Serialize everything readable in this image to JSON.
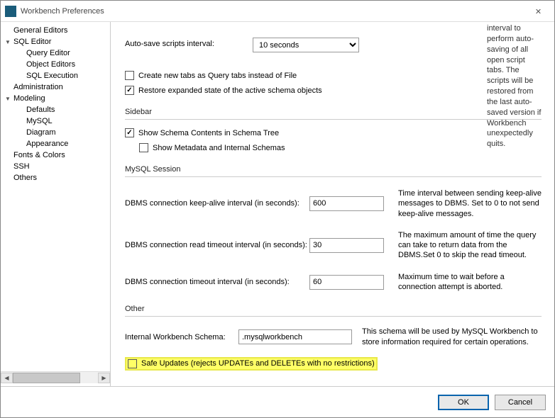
{
  "window": {
    "title": "Workbench Preferences",
    "close_glyph": "✕"
  },
  "tree": [
    {
      "label": "General Editors",
      "type": "top"
    },
    {
      "label": "SQL Editor",
      "type": "parent"
    },
    {
      "label": "Query Editor",
      "type": "child"
    },
    {
      "label": "Object Editors",
      "type": "child"
    },
    {
      "label": "SQL Execution",
      "type": "child"
    },
    {
      "label": "Administration",
      "type": "top"
    },
    {
      "label": "Modeling",
      "type": "parent"
    },
    {
      "label": "Defaults",
      "type": "child"
    },
    {
      "label": "MySQL",
      "type": "child"
    },
    {
      "label": "Diagram",
      "type": "child"
    },
    {
      "label": "Appearance",
      "type": "child"
    },
    {
      "label": "Fonts & Colors",
      "type": "top"
    },
    {
      "label": "SSH",
      "type": "top"
    },
    {
      "label": "Others",
      "type": "top"
    }
  ],
  "scroll": {
    "left": "◀",
    "right": "▶"
  },
  "top_cut_desc": "interval to perform auto-saving of all open script tabs. The scripts will be restored from the last auto-saved version if Workbench unexpectedly quits.",
  "autosave": {
    "label": "Auto-save scripts interval:",
    "value": "10 seconds"
  },
  "cb_newtabs": {
    "label": "Create new tabs as Query tabs instead of File",
    "checked": false
  },
  "cb_restore": {
    "label": "Restore expanded state of the active schema objects",
    "checked": true
  },
  "section_sidebar": "Sidebar",
  "cb_schema_tree": {
    "label": "Show Schema Contents in Schema Tree",
    "checked": true
  },
  "cb_metadata": {
    "label": "Show Metadata and Internal Schemas",
    "checked": false
  },
  "section_mysql": "MySQL Session",
  "keepalive": {
    "label": "DBMS connection keep-alive interval (in seconds):",
    "value": "600",
    "desc": "Time interval between sending keep-alive messages to DBMS. Set to 0 to not send keep-alive messages."
  },
  "readtimeout": {
    "label": "DBMS connection read timeout interval (in seconds):",
    "value": "30",
    "desc": "The maximum amount of time the query can take to return data from the DBMS.Set 0 to skip the read timeout."
  },
  "conntimeout": {
    "label": "DBMS connection timeout interval (in seconds):",
    "value": "60",
    "desc": "Maximum time to wait before a connection attempt is aborted."
  },
  "section_other": "Other",
  "internal_schema": {
    "label": "Internal Workbench Schema:",
    "value": ".mysqlworkbench",
    "desc": "This schema will be used by MySQL Workbench to store information required for certain operations."
  },
  "cb_safe": {
    "label": "Safe Updates (rejects UPDATEs and DELETEs with no restrictions)",
    "checked": false
  },
  "buttons": {
    "ok": "OK",
    "cancel": "Cancel"
  }
}
